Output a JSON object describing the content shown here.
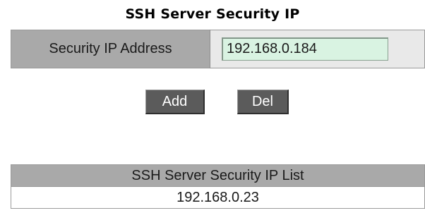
{
  "page": {
    "title": "SSH Server Security IP"
  },
  "form": {
    "label": "Security IP Address",
    "ip_value": "192.168.0.184"
  },
  "buttons": {
    "add_label": "Add",
    "del_label": "Del"
  },
  "list": {
    "header": "SSH Server Security IP List",
    "items": [
      "192.168.0.23"
    ]
  },
  "colors": {
    "header_bg": "#a9a9a9",
    "input_bg": "#d9f3e2",
    "button_bg": "#5b5b5b"
  }
}
